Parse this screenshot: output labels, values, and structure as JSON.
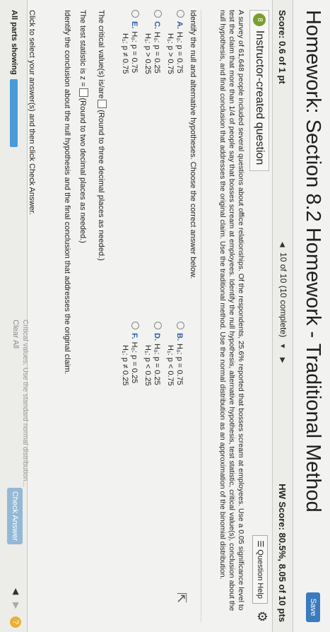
{
  "header": {
    "title": "Homework: Section 8.2 Homework - Traditional Method",
    "save_label": "Save"
  },
  "score_bar": {
    "score": "Score: 0.6 of 1 pt",
    "nav_text": "10 of 10 (10 complete)",
    "hw_score": "HW Score: 80.5%, 8.05 of 10 pts"
  },
  "question": {
    "badge": "8",
    "instructor_label": "Instructor-created question",
    "help_label": "Question Help",
    "problem_text": "A survey of 61,648 people included several questions about office relationships. Of the respondents, 25.6% reported that bosses scream at employees. Use a 0.05 significance level to test the claim that more than 1/4 of people say that bosses scream at employees. Identify the null hypothesis, alternative hypothesis, test statistic, critical value(s), conclusion about the null hypothesis, and final conclusion that addresses the original claim. Use the traditional method. Use the normal distribution as an approximation of the binomial distribution.",
    "prompt": "Identify the null and alternative hypotheses. Choose the correct answer below.",
    "options": [
      {
        "label": "A.",
        "h0": "H₀: p = 0.75",
        "h1": "H₁: p > 0.75"
      },
      {
        "label": "B.",
        "h0": "H₀: p = 0.75",
        "h1": "H₁: p < 0.75"
      },
      {
        "label": "C.",
        "h0": "H₀: p = 0.25",
        "h1": "H₁: p > 0.25"
      },
      {
        "label": "D.",
        "h0": "H₀: p = 0.25",
        "h1": "H₁: p < 0.25"
      },
      {
        "label": "E.",
        "h0": "H₀: p = 0.75",
        "h1": "H₁: p ≠ 0.75"
      },
      {
        "label": "F.",
        "h0": "H₀: p = 0.25",
        "h1": "H₁: p ≠ 0.25"
      }
    ],
    "critical_prefix": "The critical value(s) is/are",
    "critical_hint": "(Round to three decimal places as needed.)",
    "test_prefix": "The test statistic is z =",
    "test_hint": "(Round to two decimal places as needed.)",
    "conclusion_prompt": "Identify the conclusion about the null hypothesis and the final conclusion that addresses the original claim."
  },
  "footer": {
    "click_info": "Click to select your answer(s) and then click Check Answer.",
    "parts_label": "All parts showing",
    "progress": 1.0,
    "clear_label": "Clear All",
    "check_label": "Check Answer",
    "cut_text": "Critical values: Use the standard normal distribution..."
  }
}
